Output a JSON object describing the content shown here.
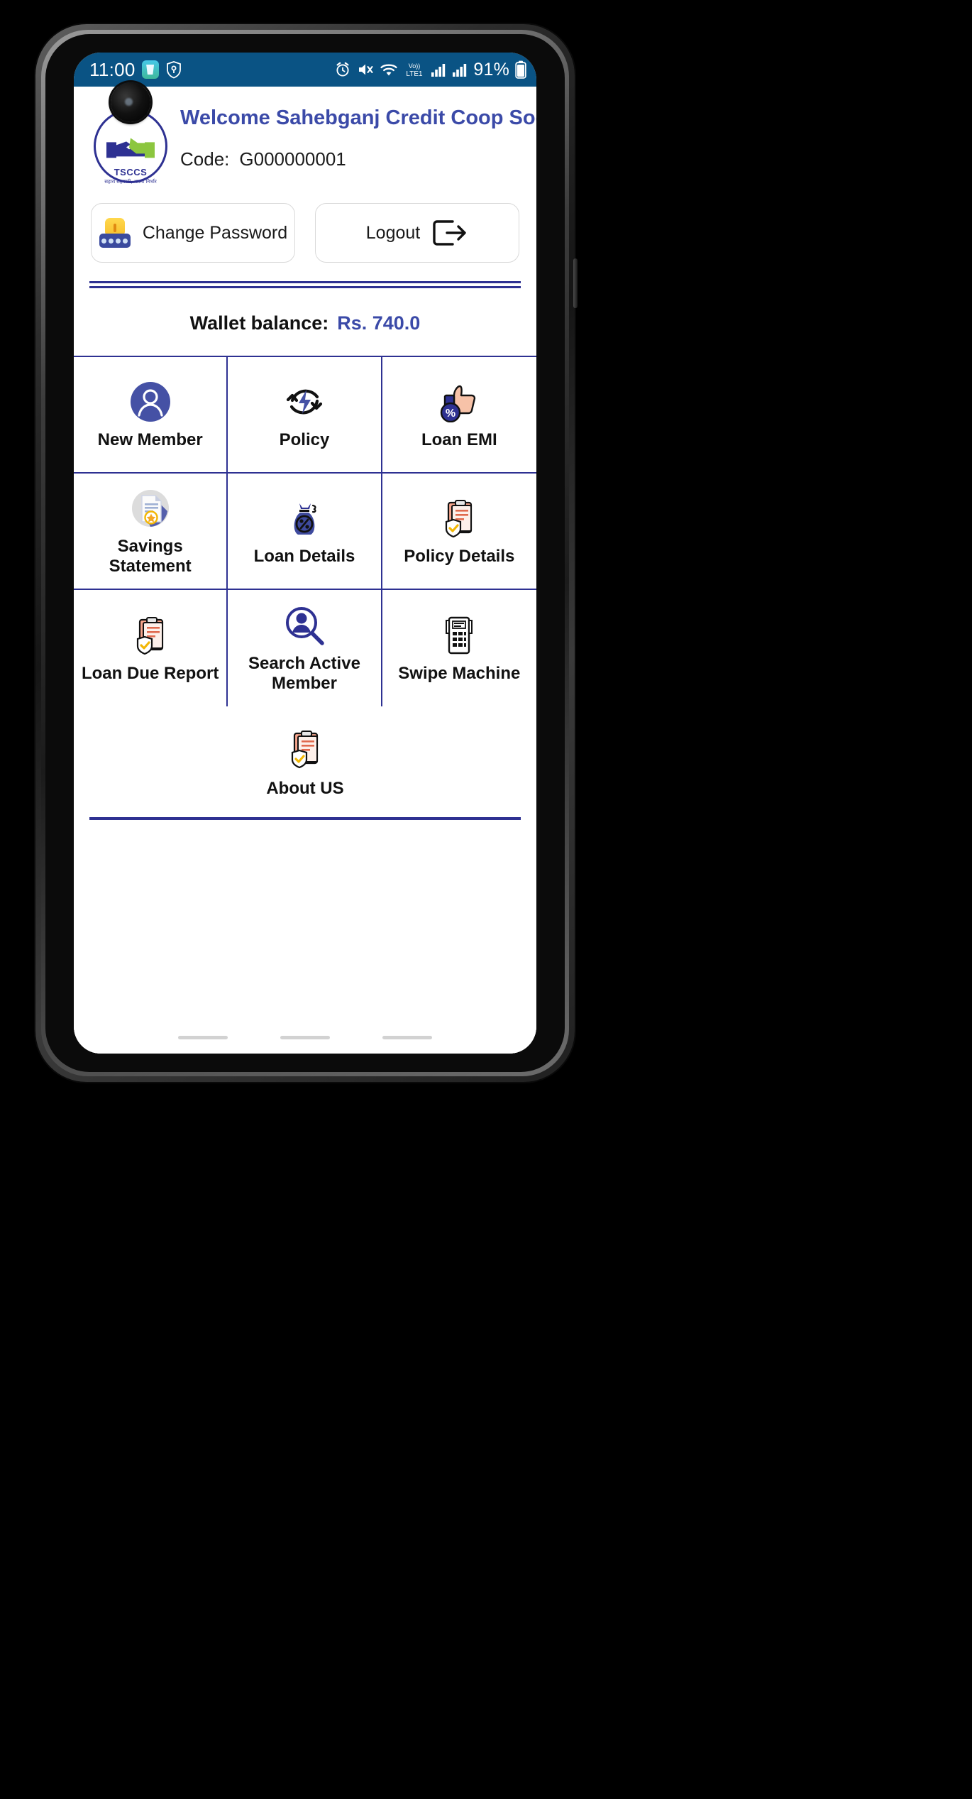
{
  "statusbar": {
    "time": "11:00",
    "battery_percent": "91%",
    "network_label": "Vo)) LTE1",
    "icons": [
      "water-reminder-icon",
      "shield-key-icon",
      "alarm-icon",
      "mute-icon",
      "wifi-icon",
      "volte-icon",
      "signal-bars-icon",
      "battery-icon"
    ]
  },
  "header": {
    "welcome_title": "Welcome Sahebganj Credit Coop Socie..",
    "code_label": "Code:",
    "code_value": "G000000001",
    "logo_text": "TSCCS",
    "logo_sub": "सहारा सहकारी, आत्मा निर्भार"
  },
  "actions": {
    "change_password": "Change Password",
    "logout": "Logout"
  },
  "wallet": {
    "label": "Wallet balance:",
    "value": "Rs. 740.0"
  },
  "menu": {
    "items": [
      {
        "label": "New Member",
        "icon": "user-avatar-icon"
      },
      {
        "label": "Policy",
        "icon": "refresh-bolt-icon"
      },
      {
        "label": "Loan EMI",
        "icon": "thumbs-up-percent-icon"
      },
      {
        "label": "Savings Statement",
        "icon": "document-star-icon"
      },
      {
        "label": "Loan Details",
        "icon": "money-bag-percent-icon"
      },
      {
        "label": "Policy Details",
        "icon": "clipboard-shield-icon"
      },
      {
        "label": "Loan Due Report",
        "icon": "clipboard-shield-icon"
      },
      {
        "label": "Search Active Member",
        "icon": "search-person-icon"
      },
      {
        "label": "Swipe Machine",
        "icon": "pos-terminal-icon"
      }
    ],
    "about": {
      "label": "About US",
      "icon": "clipboard-shield-icon"
    }
  },
  "colors": {
    "statusbar_bg": "#0a5384",
    "brand_blue": "#2e3192",
    "accent_blue": "#3b4aa8",
    "icon_blue": "#4551a5"
  }
}
